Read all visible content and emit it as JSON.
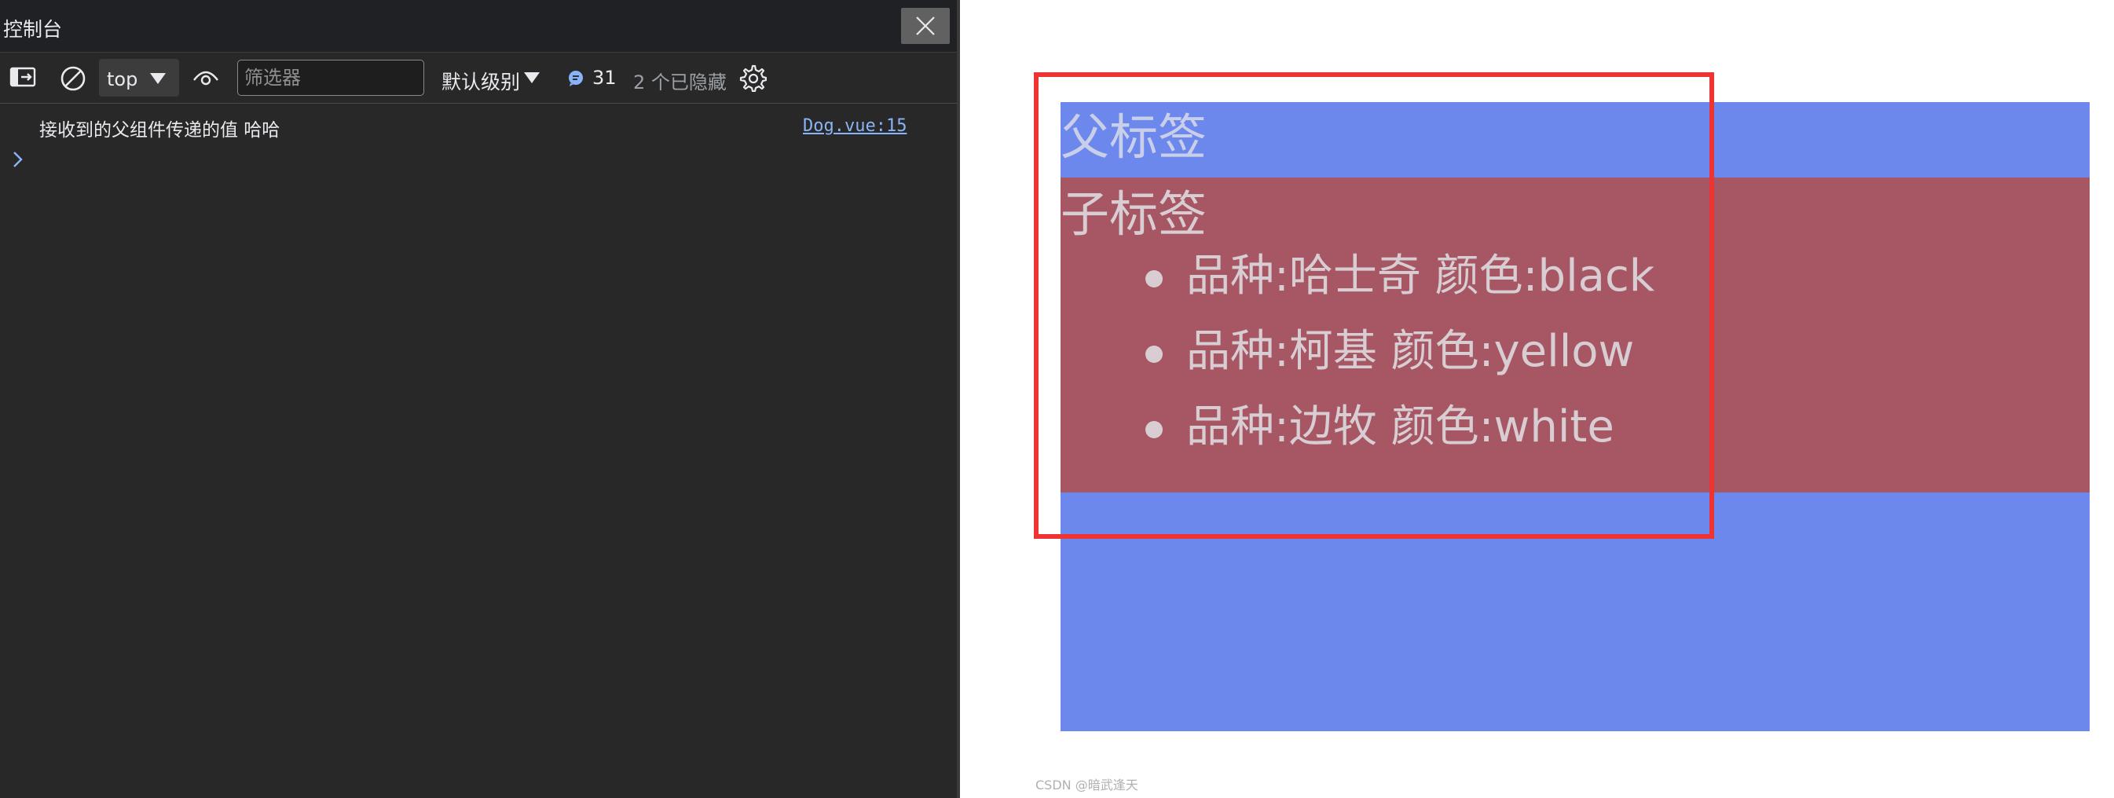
{
  "devtools": {
    "drawer_title": "控制台",
    "toolbar": {
      "context": "top",
      "filter_placeholder": "筛选器",
      "levels_label": "默认级别",
      "message_count": "31",
      "hidden_label": "2 个已隐藏"
    },
    "console": {
      "log": {
        "message": "接收到的父组件传递的值 哈哈",
        "source": "Dog.vue:15"
      }
    }
  },
  "page": {
    "parent_heading": "父标签",
    "child_heading": "子标签",
    "dogs": [
      "品种:哈士奇 颜色:black",
      "品种:柯基 颜色:yellow",
      "品种:边牧 颜色:white"
    ],
    "colors": {
      "parent_background": "#6c88ec",
      "child_background": "#a65763",
      "highlight_border": "#ee3333"
    }
  },
  "watermark": "CSDN @暗武逢天"
}
